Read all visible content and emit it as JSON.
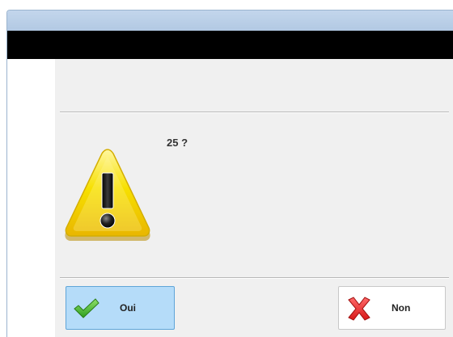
{
  "dialog": {
    "message": "25 ?",
    "icon": "warning-icon"
  },
  "buttons": {
    "yes_label": "Oui",
    "yes_icon": "checkmark-icon",
    "no_label": "Non",
    "no_icon": "cross-icon"
  },
  "colors": {
    "titlebar": "#b9cfe8",
    "header_band": "#000000",
    "content_bg": "#f0f0f0",
    "yes_button_bg": "#b5dcf9",
    "no_button_bg": "#ffffff",
    "warning_yellow": "#f5d800"
  }
}
